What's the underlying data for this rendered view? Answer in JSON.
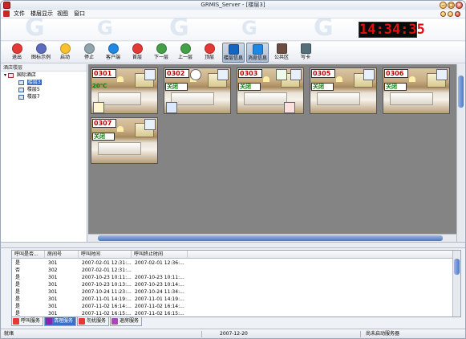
{
  "window": {
    "title": "GRMIS_Server - [楼层3]"
  },
  "menu": {
    "items": [
      "文件",
      "楼层显示",
      "视图",
      "窗口"
    ]
  },
  "clock": {
    "time": "14:34:35"
  },
  "toolbar": {
    "buttons": [
      {
        "label": "退出",
        "icon": "exit-icon",
        "color": "#e53935"
      },
      {
        "label": "图标示例",
        "icon": "legend-icon",
        "color": "#5c6bc0"
      },
      {
        "label": "启动",
        "icon": "start-icon",
        "color": "#fbc02d"
      },
      {
        "label": "停止",
        "icon": "stop-icon",
        "color": "#90a4ae"
      },
      {
        "label": "客户端",
        "icon": "client-icon",
        "color": "#1e88e5"
      },
      {
        "label": "首层",
        "icon": "first-floor-icon",
        "color": "#e53935"
      },
      {
        "label": "下一层",
        "icon": "next-floor-icon",
        "color": "#43a047"
      },
      {
        "label": "上一层",
        "icon": "prev-floor-icon",
        "color": "#43a047"
      },
      {
        "label": "顶层",
        "icon": "top-floor-icon",
        "color": "#e53935"
      },
      {
        "label": "楼层信息",
        "icon": "floor-info-icon",
        "color": "#1565c0"
      },
      {
        "label": "消息信息",
        "icon": "message-info-icon",
        "color": "#1e88e5"
      },
      {
        "label": "公共区",
        "icon": "public-area-icon",
        "color": "#6d4c41"
      },
      {
        "label": "写卡",
        "icon": "write-card-icon",
        "color": "#546e7a"
      }
    ]
  },
  "tree": {
    "header": "酒店楼层",
    "root": "国际酒店",
    "floors": [
      "楼层3",
      "楼层5",
      "楼层7"
    ],
    "selected": "楼层3"
  },
  "rooms": [
    {
      "number": "0301",
      "status": "20℃"
    },
    {
      "number": "0302",
      "status": "关闭"
    },
    {
      "number": "0303",
      "status": "关闭"
    },
    {
      "number": "0305",
      "status": "关闭"
    },
    {
      "number": "0306",
      "status": "关闭"
    },
    {
      "number": "0307",
      "status": "关闭"
    }
  ],
  "log": {
    "columns": [
      "呼叫是否...",
      "房间号",
      "呼叫时间",
      "呼叫终止时间"
    ],
    "rows": [
      [
        "是",
        "301",
        "2007-02-01 12:31:...",
        "2007-02-01 12:36:..."
      ],
      [
        "否",
        "302",
        "2007-02-01 12:31:...",
        ""
      ],
      [
        "是",
        "301",
        "2007-10-23 10:11:...",
        "2007-10-23 10:11:..."
      ],
      [
        "是",
        "301",
        "2007-10-23 10:13:...",
        "2007-10-23 10:14:..."
      ],
      [
        "是",
        "301",
        "2007-10-24 11:23:...",
        "2007-10-24 11:34:..."
      ],
      [
        "是",
        "301",
        "2007-11-01 14:19:...",
        "2007-11-01 14:19:..."
      ],
      [
        "是",
        "301",
        "2007-11-02 16:14:...",
        "2007-11-02 16:14:..."
      ],
      [
        "是",
        "301",
        "2007-11-02 16:15:...",
        "2007-11-02 16:15:..."
      ]
    ]
  },
  "tabs": [
    {
      "label": "呼叫服务",
      "color": "#e53935"
    },
    {
      "label": "清理服务",
      "color": "#8e24aa"
    },
    {
      "label": "勿扰服务",
      "color": "#e53935"
    },
    {
      "label": "退房服务",
      "color": "#ab47bc"
    }
  ],
  "status": {
    "left": "就绪",
    "date": "2007-12-20",
    "right": "尚未启动服务器"
  }
}
